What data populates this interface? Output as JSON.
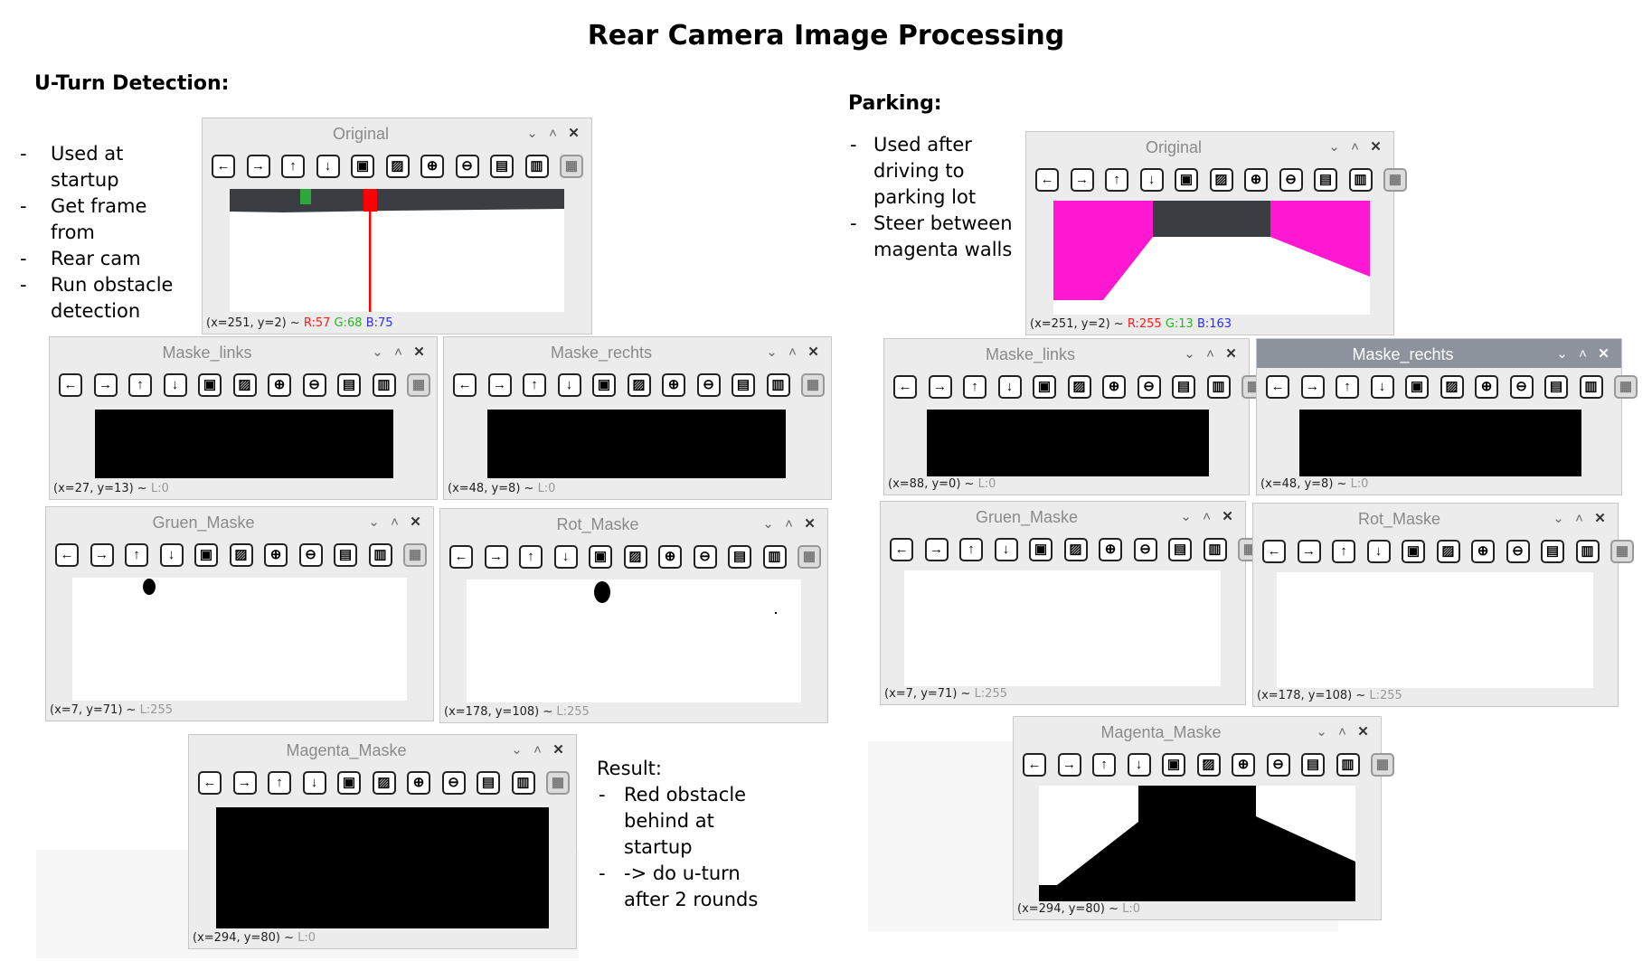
{
  "title": "Rear Camera Image Processing",
  "left": {
    "heading": "U-Turn Detection:",
    "bullets": [
      {
        "dash": "-",
        "text": "Used at startup"
      },
      {
        "dash": "-",
        "text": "Get frame from"
      },
      {
        "dash": "-",
        "text": "Rear cam"
      },
      {
        "dash": "-",
        "text": "Run obstacle detection"
      }
    ],
    "result_heading": "Result:",
    "result_bullets": [
      {
        "dash": "-",
        "text": "Red obstacle behind at startup"
      },
      {
        "dash": "-",
        "text": "-> do u-turn after 2 rounds"
      }
    ]
  },
  "right": {
    "heading": "Parking:",
    "bullets": [
      {
        "dash": "-",
        "text": "Used after driving to parking lot"
      },
      {
        "dash": "-",
        "text": "Steer between magenta walls"
      }
    ]
  },
  "controls": {
    "collapse": "⌄",
    "minimize": "˄",
    "close": "✕"
  },
  "toolbar_icons": [
    {
      "name": "pan-left",
      "glyph": "←"
    },
    {
      "name": "pan-right",
      "glyph": "→"
    },
    {
      "name": "pan-up",
      "glyph": "↑"
    },
    {
      "name": "pan-down",
      "glyph": "↓"
    },
    {
      "name": "zoom-image",
      "glyph": "▣"
    },
    {
      "name": "zoom-fit",
      "glyph": "▨"
    },
    {
      "name": "zoom-in",
      "glyph": "⊕"
    },
    {
      "name": "zoom-out",
      "glyph": "⊖"
    },
    {
      "name": "save",
      "glyph": "▤"
    },
    {
      "name": "copy-clipboard",
      "glyph": "▥"
    },
    {
      "name": "properties",
      "glyph": "▦"
    }
  ],
  "windows": {
    "l_original": {
      "name": "Original",
      "status": "(x=251, y=2) ~",
      "r": "R:57",
      "g": "G:68",
      "b": "B:75"
    },
    "l_maske_links": {
      "name": "Maske_links",
      "status": "(x=27, y=13) ~",
      "level": "L:0"
    },
    "l_maske_rechts": {
      "name": "Maske_rechts",
      "status": "(x=48, y=8) ~",
      "level": "L:0"
    },
    "l_gruen": {
      "name": "Gruen_Maske",
      "status": "(x=7, y=71) ~",
      "level": "L:255"
    },
    "l_rot": {
      "name": "Rot_Maske",
      "status": "(x=178, y=108) ~",
      "level": "L:255"
    },
    "l_magenta": {
      "name": "Magenta_Maske",
      "status": "(x=294, y=80) ~",
      "level": "L:0"
    },
    "r_original": {
      "name": "Original",
      "status": "(x=251, y=2) ~",
      "r": "R:255",
      "g": "G:13",
      "b": "B:163"
    },
    "r_maske_links": {
      "name": "Maske_links",
      "status": "(x=88, y=0) ~",
      "level": "L:0"
    },
    "r_maske_rechts": {
      "name": "Maske_rechts",
      "status": "(x=48, y=8) ~",
      "level": "L:0"
    },
    "r_gruen": {
      "name": "Gruen_Maske",
      "status": "(x=7, y=71) ~",
      "level": "L:255"
    },
    "r_rot": {
      "name": "Rot_Maske",
      "status": "(x=178, y=108) ~",
      "level": "L:255"
    },
    "r_magenta": {
      "name": "Magenta_Maske",
      "status": "(x=294, y=80) ~",
      "level": "L:0"
    }
  },
  "colors": {
    "magenta": "#ff18d2",
    "wall_gray": "#3a3e42",
    "red_obstacle": "#ff0000",
    "green_obstacle": "#2fa83a",
    "active_titlebar": "#8c939c"
  }
}
